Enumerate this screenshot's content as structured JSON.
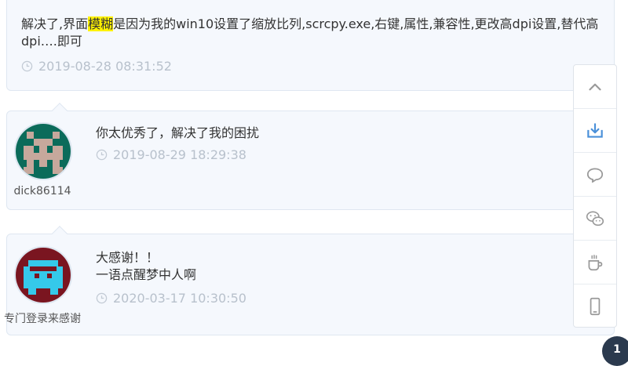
{
  "comments": [
    {
      "text_before": "解决了,界面",
      "highlight": "模糊",
      "text_after": "是因为我的win10设置了缩放比列,scrcpy.exe,右键,属性,兼容性,更改高dpi设置,替代高dpi….即可",
      "time": "2019-08-28 08:31:52"
    },
    {
      "user": "dick86114",
      "lines": [
        "你太优秀了，解决了我的困扰"
      ],
      "time": "2019-08-29 18:29:38"
    },
    {
      "user": "专门登录来感谢",
      "lines": [
        "大感谢！！",
        "一语点醒梦中人啊"
      ],
      "time": "2020-03-17 10:30:50"
    }
  ],
  "sidebar": {
    "items": [
      "chevron-up-icon",
      "download-icon",
      "comment-icon",
      "wechat-icon",
      "coffee-icon",
      "mobile-icon"
    ],
    "accent": "#4a90d9",
    "icon_color": "#999999"
  },
  "badge": {
    "count": "1"
  }
}
